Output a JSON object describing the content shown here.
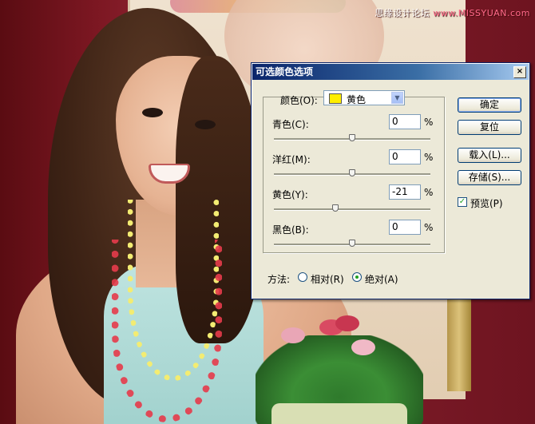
{
  "watermark": {
    "prefix": "思缘设计论坛 ",
    "site": "www.MISSYUAN.com"
  },
  "dialog": {
    "title": "可选颜色选项",
    "close_glyph": "×",
    "color": {
      "label": "颜色(O):",
      "value": "黄色",
      "swatch_color": "#ffee00"
    },
    "sliders": [
      {
        "label": "青色(C):",
        "value": "0",
        "unit": "%",
        "position": 0.5
      },
      {
        "label": "洋红(M):",
        "value": "0",
        "unit": "%",
        "position": 0.5
      },
      {
        "label": "黄色(Y):",
        "value": "-21",
        "unit": "%",
        "position": 0.395
      },
      {
        "label": "黑色(B):",
        "value": "0",
        "unit": "%",
        "position": 0.5
      }
    ],
    "buttons": {
      "ok": "确定",
      "reset": "复位",
      "load": "载入(L)...",
      "save": "存储(S)..."
    },
    "preview": {
      "label": "预览(P)",
      "checked": true
    },
    "method": {
      "label": "方法:",
      "relative": "相对(R)",
      "absolute": "绝对(A)",
      "selected": "absolute"
    }
  }
}
